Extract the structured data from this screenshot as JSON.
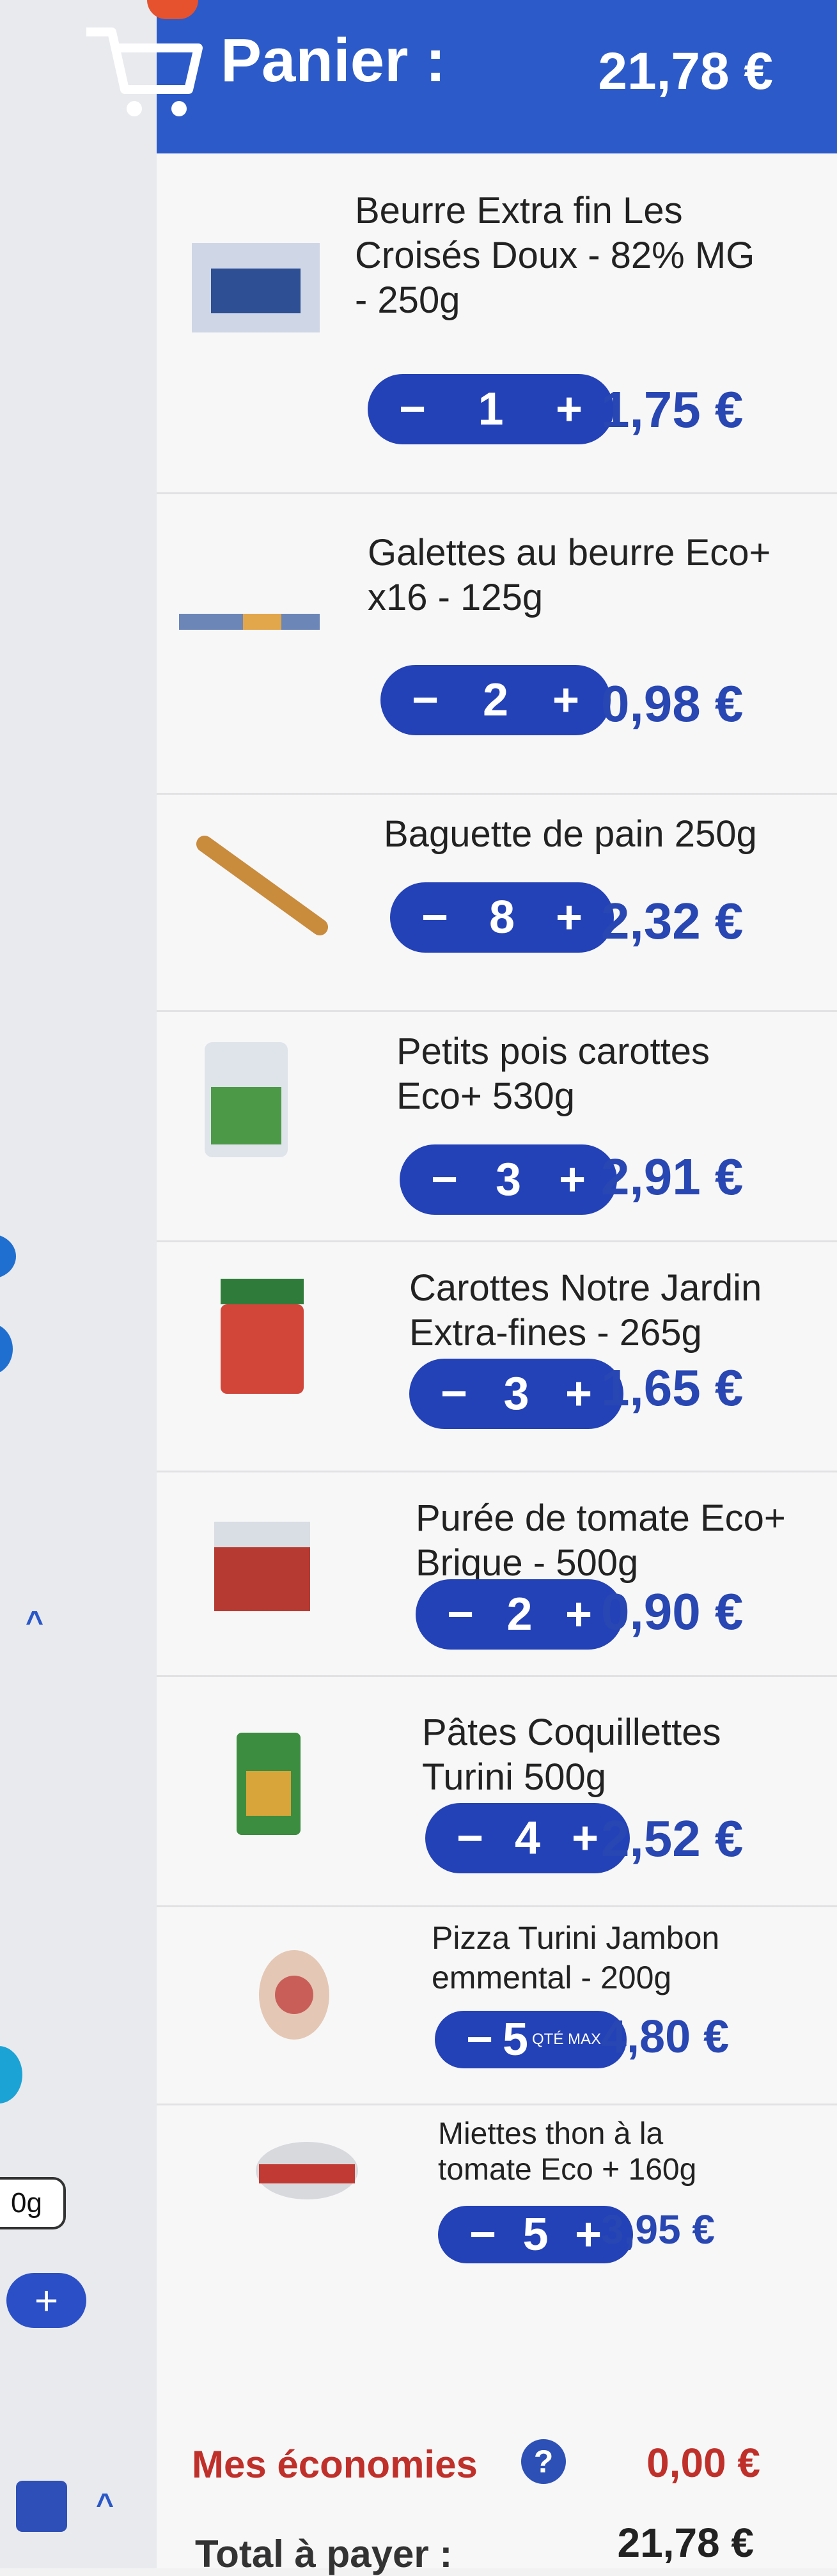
{
  "header": {
    "title": "Panier :",
    "total": "21,78 €"
  },
  "left_fragment": {
    "weight_label": "0g"
  },
  "items": [
    {
      "name_lines": [
        "Beurre Extra fin Les",
        "Croisés Doux - 82% MG",
        "- 250g"
      ],
      "qty": "1",
      "price": "1,75 €"
    },
    {
      "name_lines": [
        "Galettes au beurre Eco+",
        "x16 - 125g"
      ],
      "qty": "2",
      "price": "0,98 €"
    },
    {
      "name_lines": [
        "Baguette de pain 250g"
      ],
      "qty": "8",
      "price": "2,32 €"
    },
    {
      "name_lines": [
        "Petits pois carottes",
        "Eco+ 530g"
      ],
      "qty": "3",
      "price": "2,91 €"
    },
    {
      "name_lines": [
        "Carottes Notre Jardin",
        "Extra-fines - 265g"
      ],
      "qty": "3",
      "price": "1,65 €"
    },
    {
      "name_lines": [
        "Purée de tomate Eco+",
        "Brique - 500g"
      ],
      "qty": "2",
      "price": "0,90 €"
    },
    {
      "name_lines": [
        "Pâtes Coquillettes",
        "Turini 500g"
      ],
      "qty": "4",
      "price": "2,52 €"
    },
    {
      "name_lines": [
        "Pizza Turini Jambon",
        "emmental - 200g"
      ],
      "qty": "5",
      "price": "4,80 €",
      "max_label": "QTÉ MAX"
    },
    {
      "name_lines": [
        "Miettes thon à la",
        "tomate Eco + 160g"
      ],
      "qty": "5",
      "price": "3,95 €"
    }
  ],
  "controls": {
    "minus": "−",
    "plus": "+"
  },
  "footer": {
    "savings_label": "Mes économies",
    "savings_value": "0,00 €",
    "total_label": "Total à payer :",
    "total_value": "21,78 €"
  },
  "icons": [
    "cart-icon",
    "help-icon",
    "chevron-up-icon",
    "plus-icon",
    "thermometer-icon",
    "list-icon"
  ],
  "colors": {
    "header_bg": "#2c5bc9",
    "qty_button": "#2442b7",
    "price": "#2947b2",
    "savings": "#c0302a"
  }
}
